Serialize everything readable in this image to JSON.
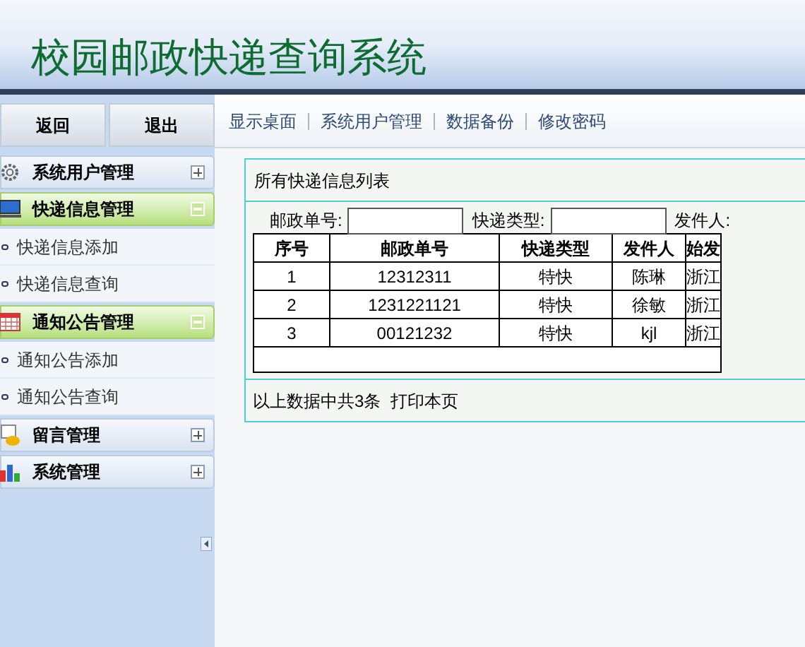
{
  "header": {
    "title": "校园邮政快递查询系统"
  },
  "top_buttons": [
    "返回",
    "退出"
  ],
  "nav_links": [
    "显示桌面",
    "系统用户管理",
    "数据备份",
    "修改密码"
  ],
  "sidebar": [
    {
      "label": "系统用户管理",
      "expanded": false
    },
    {
      "label": "快递信息管理",
      "expanded": true,
      "children": [
        {
          "label": "快递信息添加"
        },
        {
          "label": "快递信息查询"
        }
      ]
    },
    {
      "label": "通知公告管理",
      "expanded": true,
      "children": [
        {
          "label": "通知公告添加"
        },
        {
          "label": "通知公告查询"
        }
      ]
    },
    {
      "label": "留言管理",
      "expanded": false
    },
    {
      "label": "系统管理",
      "expanded": false
    }
  ],
  "panel": {
    "title": "所有快递信息列表",
    "filters": [
      {
        "label": "邮政单号:",
        "kind": "input"
      },
      {
        "label": "快递类型:",
        "kind": "input"
      },
      {
        "label": "发件人:",
        "kind": "label"
      }
    ],
    "table": {
      "columns": [
        "序号",
        "邮政单号",
        "快递类型",
        "发件人",
        "始发"
      ],
      "rows": [
        [
          "1",
          "12312311",
          "特快",
          "陈琳",
          "浙江"
        ],
        [
          "2",
          "1231221121",
          "特快",
          "徐敏",
          "浙江"
        ],
        [
          "3",
          "00121232",
          "特快",
          "kjl",
          "浙江"
        ]
      ]
    },
    "footer": "以上数据中共3条  打印本页"
  }
}
